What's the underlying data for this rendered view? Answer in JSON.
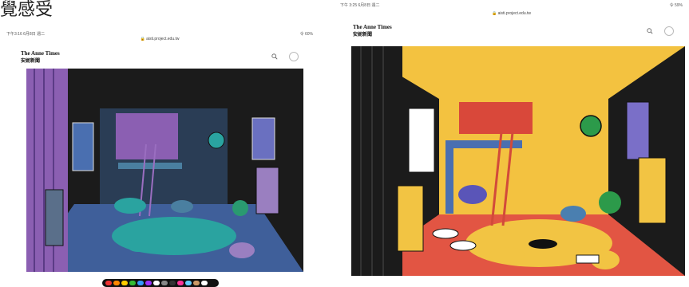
{
  "caption": "覺感受",
  "left": {
    "status_left": "下午3:16 6月8日 週二",
    "status_right": "令 60%",
    "url": "🔒 aisti.project.edu.tw",
    "brand_en": "The Anne Times",
    "brand_cn": "安妮新聞"
  },
  "right": {
    "status_left": "下午 3:25 6月8日 週二",
    "status_right": "令 59%",
    "url": "🔒 aisti.project.edu.tw",
    "brand_en": "The Anne Times",
    "brand_cn": "安妮新聞"
  },
  "colors": {
    "left_wall": "#8b5fb2",
    "left_floor": "#3f5f9a",
    "right_wall": "#f3c240",
    "right_floor": "#e25543",
    "dark": "#1b1b1b"
  },
  "palette": [
    "#e33",
    "#f80",
    "#fc0",
    "#3b3",
    "#39f",
    "#93f",
    "#fff",
    "#888",
    "#333",
    "#f39",
    "#6cf",
    "#c96",
    "#fff"
  ]
}
